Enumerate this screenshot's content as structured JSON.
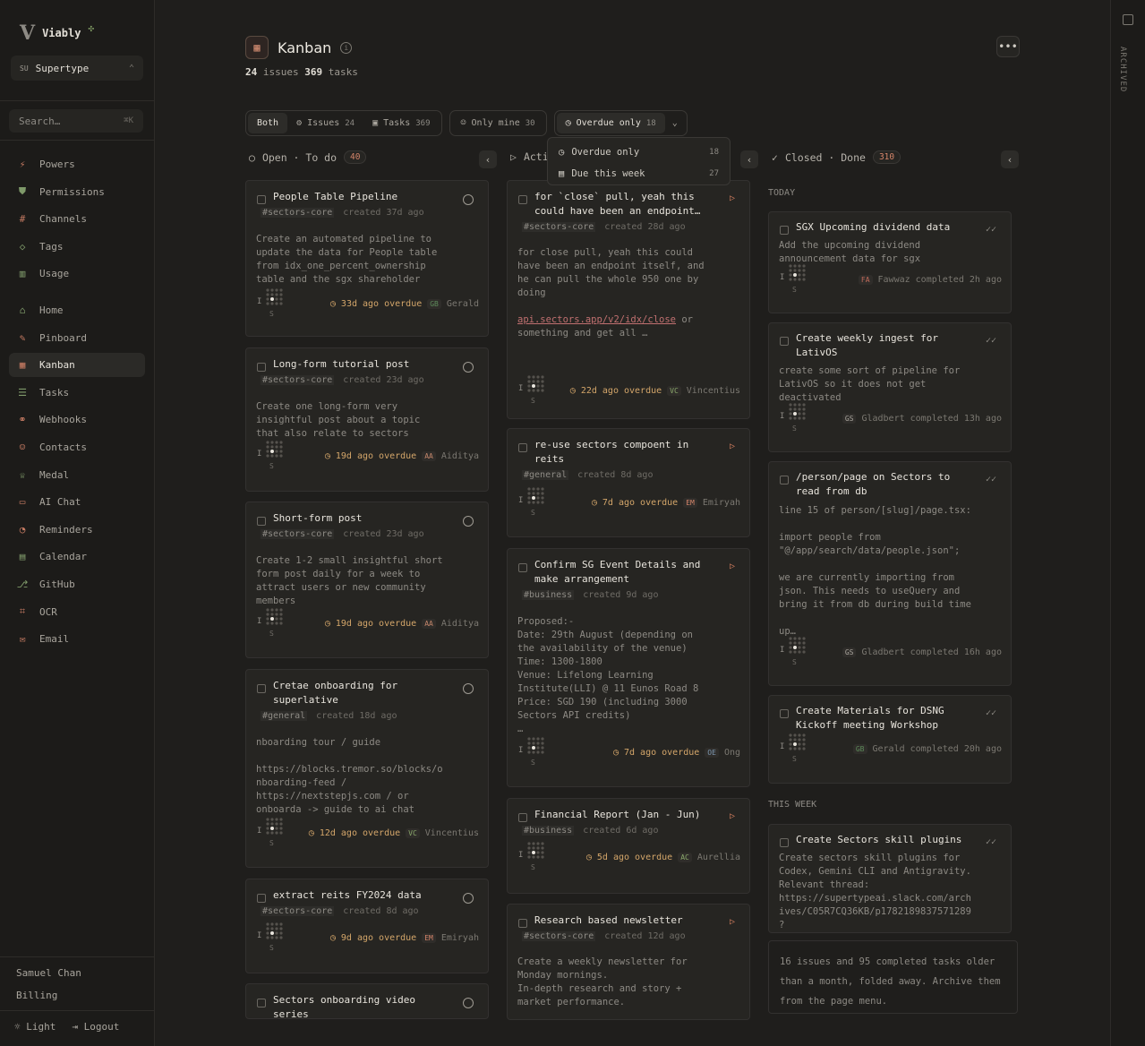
{
  "brand": {
    "name": "Viably",
    "logo": "V"
  },
  "workspace": {
    "badge": "SU",
    "name": "Supertype"
  },
  "search": {
    "placeholder": "Search…",
    "shortcut": "⌘K"
  },
  "nav_top": [
    {
      "label": "Powers",
      "icon": "⚡"
    },
    {
      "label": "Permissions",
      "icon": "⛊"
    },
    {
      "label": "Channels",
      "icon": "#"
    },
    {
      "label": "Tags",
      "icon": "◇"
    },
    {
      "label": "Usage",
      "icon": "▥"
    }
  ],
  "nav_main": [
    {
      "label": "Home",
      "icon": "⌂"
    },
    {
      "label": "Pinboard",
      "icon": "✎"
    },
    {
      "label": "Kanban",
      "icon": "▦"
    },
    {
      "label": "Tasks",
      "icon": "☰"
    },
    {
      "label": "Webhooks",
      "icon": "⚭"
    },
    {
      "label": "Contacts",
      "icon": "☺"
    },
    {
      "label": "Medal",
      "icon": "♕"
    },
    {
      "label": "AI Chat",
      "icon": "▭"
    },
    {
      "label": "Reminders",
      "icon": "◔"
    },
    {
      "label": "Calendar",
      "icon": "▤"
    },
    {
      "label": "GitHub",
      "icon": "⎇"
    },
    {
      "label": "OCR",
      "icon": "⌗"
    },
    {
      "label": "Email",
      "icon": "✉"
    }
  ],
  "user": {
    "name": "Samuel Chan",
    "billing": "Billing",
    "theme": "Light",
    "logout": "Logout"
  },
  "page": {
    "title": "Kanban",
    "issues_count": "24",
    "issues_label": "issues",
    "tasks_count": "369",
    "tasks_label": "tasks"
  },
  "filters": {
    "both": "Both",
    "issues": "Issues",
    "issues_count": "24",
    "tasks": "Tasks",
    "tasks_count": "369",
    "mine": "Only mine",
    "mine_count": "30",
    "overdue": "Overdue only",
    "overdue_count": "18"
  },
  "dropdown": [
    {
      "label": "Overdue only",
      "count": "18"
    },
    {
      "label": "Due this week",
      "count": "27"
    }
  ],
  "columns": {
    "open": {
      "title": "Open · To do",
      "count": "40"
    },
    "active": {
      "title": "Acti"
    },
    "closed": {
      "title": "Closed · Done",
      "count": "310"
    }
  },
  "sections": {
    "today": "TODAY",
    "this_week": "THIS WEEK"
  },
  "open_cards": [
    {
      "title": "People Table Pipeline",
      "tag": "#sectors-core",
      "created": "created 37d ago",
      "body": "Create an automated pipeline to\nupdate the data for People table\nfrom idx_one_percent_ownership\ntable and the sgx shareholder",
      "due": "33d ago overdue",
      "av": "GB",
      "assignee": "Gerald"
    },
    {
      "title": "Long-form tutorial post",
      "tag": "#sectors-core",
      "created": "created 23d ago",
      "body": "Create one long-form very\ninsightful post about a topic\nthat also relate to sectors",
      "due": "19d ago overdue",
      "av": "AA",
      "assignee": "Aiditya"
    },
    {
      "title": "Short-form post",
      "tag": "#sectors-core",
      "created": "created 23d ago",
      "body": "Create 1-2 small insightful short\nform post daily for a week to\nattract users or new community\nmembers",
      "due": "19d ago overdue",
      "av": "AA",
      "assignee": "Aiditya"
    },
    {
      "title": "Cretae onboarding for\nsuperlative",
      "tag": "#general",
      "created": "created 18d ago",
      "body": "nboarding tour / guide\n\nhttps://blocks.tremor.so/blocks/o\nnboarding-feed /\nhttps://nextstepjs.com / or\nonboarda -> guide to ai chat",
      "due": "12d ago overdue",
      "av": "VC",
      "assignee": "Vincentius"
    },
    {
      "title": "extract reits FY2024 data",
      "tag": "#sectors-core",
      "created": "created 8d ago",
      "body": "",
      "due": "9d ago overdue",
      "av": "EM",
      "assignee": "Emiryah"
    },
    {
      "title": "Sectors onboarding video\nseries",
      "tag": "",
      "created": "",
      "body": "",
      "due": "",
      "av": "",
      "assignee": ""
    }
  ],
  "active_cards": [
    {
      "title": "for `close` pull, yeah this\ncould have been an endpoint…",
      "tag": "#sectors-core",
      "created": "created 28d ago",
      "body": "for close pull, yeah this could\nhave been an endpoint itself, and\nhe can pull the whole 950 one by\ndoing\n\napi.sectors.app/v2/idx/close or\nsomething and get all …",
      "due": "22d ago overdue",
      "av": "VC",
      "assignee": "Vincentius"
    },
    {
      "title": "re-use sectors compoent in\nreits",
      "tag": "#general",
      "created": "created 8d ago",
      "body": "",
      "due": "7d ago overdue",
      "av": "EM",
      "assignee": "Emiryah"
    },
    {
      "title": "Confirm SG Event Details and\nmake arrangement",
      "tag": "#business",
      "created": "created 9d ago",
      "body": "Proposed:-\nDate: 29th August (depending on\nthe availability of the venue)\nTime: 1300-1800\nVenue: Lifelong Learning\nInstitute(LLI) @ 11 Eunos Road 8\nPrice: SGD 190 (including 3000\nSectors API credits)\n…",
      "due": "7d ago overdue",
      "av": "OE",
      "assignee": "Ong"
    },
    {
      "title": "Financial Report (Jan - Jun)",
      "tag": "#business",
      "created": "created 6d ago",
      "body": "",
      "due": "5d ago overdue",
      "av": "AC",
      "assignee": "Aurellia"
    },
    {
      "title": "Research based newsletter",
      "tag": "#sectors-core",
      "created": "created 12d ago",
      "body": "Create a weekly newsletter for\nMonday mornings.\nIn-depth research and story +\nmarket performance.",
      "due": "",
      "av": "",
      "assignee": ""
    }
  ],
  "closed_cards": [
    {
      "title": "SGX Upcoming dividend data",
      "body": "Add the upcoming dividend\nannouncement data for sgx",
      "av": "FA",
      "done": "Fawwaz completed 2h ago"
    },
    {
      "title": "Create weekly ingest for\nLativOS",
      "body": "create some sort of pipeline for\nLativOS so it does not get\ndeactivated",
      "av": "GS",
      "done": "Gladbert completed 13h ago"
    },
    {
      "title": "/person/page on Sectors to\nread from db",
      "body": "line 15 of person/[slug]/page.tsx:\n\nimport people from\n\"@/app/search/data/people.json\";\n\nwe are currently importing from\njson. This needs to useQuery and\nbring it from db during build time\n\nup…",
      "av": "GS",
      "done": "Gladbert completed 16h ago"
    },
    {
      "title": "Create Materials for DSNG\nKickoff meeting Workshop",
      "body": "",
      "av": "GB",
      "done": "Gerald completed 20h ago"
    },
    {
      "title": "Create Sectors skill plugins",
      "body": "Create sectors skill plugins for\nCodex, Gemini CLI and Antigravity.\nRelevant thread:\nhttps://supertypeai.slack.com/arch\nives/C05R7CQ36KB/p1782189837571289\n?",
      "av": "",
      "done": ""
    }
  ],
  "footnote": "16 issues and 95 completed tasks older than a month, folded away. Archive them from the page menu.",
  "rail": {
    "label": "ARCHIVED"
  },
  "colors": {
    "accent": "#d4856a",
    "overdue": "#d4a66a",
    "bg": "#1f1e1c",
    "card": "#262522"
  }
}
